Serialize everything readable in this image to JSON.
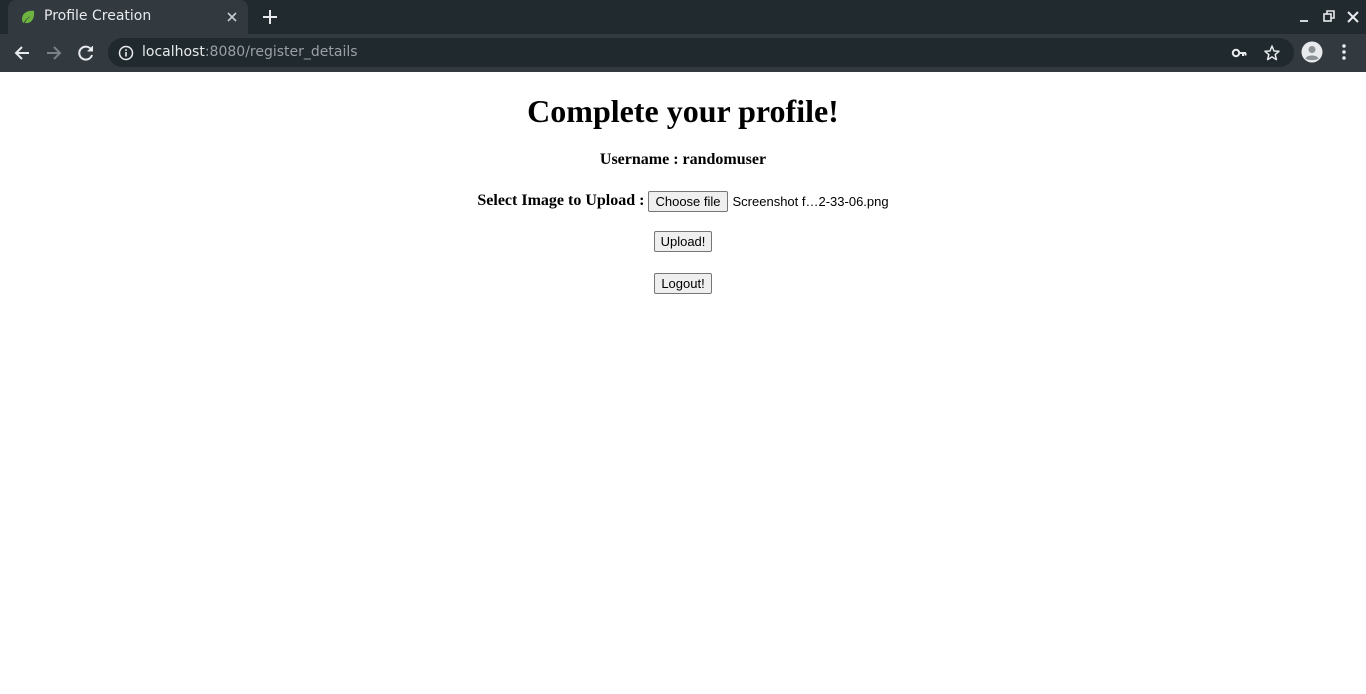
{
  "browser": {
    "tab_title": "Profile Creation",
    "url_host": "localhost",
    "url_rest": ":8080/register_details",
    "colors": {
      "tabbar_bg": "#202a2f",
      "toolbar_bg": "#323a3f",
      "favicon_green": "#6db33f"
    }
  },
  "page": {
    "title": "Complete your profile!",
    "username_line": "Username : randomuser",
    "upload_label": "Select Image to Upload :",
    "choose_file_label": "Choose file",
    "selected_file_name": "Screenshot f…2-33-06.png",
    "upload_button": "Upload!",
    "logout_button": "Logout!"
  },
  "icons": [
    "spring-leaf-icon",
    "close-icon",
    "plus-icon",
    "minimize-icon",
    "restore-icon",
    "window-close-icon",
    "back-arrow-icon",
    "forward-arrow-icon",
    "reload-icon",
    "info-icon",
    "key-icon",
    "star-icon",
    "account-icon",
    "more-vert-icon"
  ]
}
